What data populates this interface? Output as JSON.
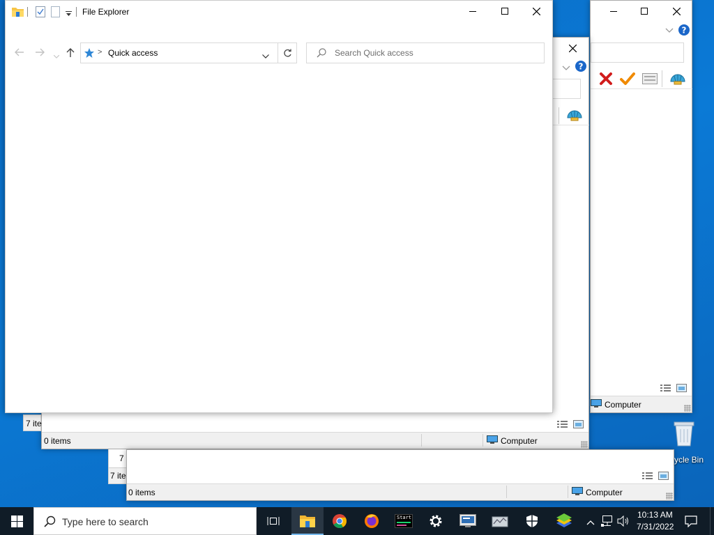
{
  "explorer": {
    "title": "File Explorer",
    "breadcrumb": {
      "location": "Quick access",
      "separator": ">"
    },
    "search": {
      "placeholder": "Search Quick access"
    }
  },
  "window_back": {
    "status_location": "Computer"
  },
  "window_mid": {
    "items_count": "0 items",
    "status_location": "Computer",
    "partial_left_status": "7 ite"
  },
  "window_front_bottom": {
    "items_count": "0 items",
    "status_location": "Computer",
    "partial_1": "7 i",
    "partial_2": "7 ite"
  },
  "desktop": {
    "recycle_bin_label": "ycle Bin"
  },
  "taskbar": {
    "search_placeholder": "Type here to search",
    "clock_time": "10:13 AM",
    "clock_date": "7/31/2022",
    "start_app_label": "Start",
    "accent_color": "#76b9ed",
    "apps": [
      "task-view",
      "file-explorer",
      "chrome",
      "firefox",
      "terminal",
      "settings",
      "monitor",
      "network-tool",
      "security",
      "bluestacks"
    ]
  }
}
